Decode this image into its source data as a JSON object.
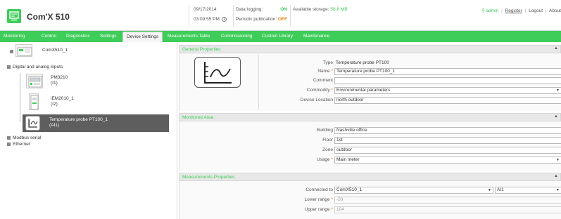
{
  "header": {
    "product_title": "Com'X 510",
    "date": "09/17/2014",
    "time": "03:09:55 PM",
    "data_logging_label": "Data logging:",
    "data_logging_value": "ON",
    "periodic_publication_label": "Periodic publication:",
    "periodic_publication_value": "OFF",
    "storage_label": "Available storage:",
    "storage_value": "58.8 MB",
    "user_icon": "user-icon",
    "user_name": "admin",
    "register": "Register",
    "logout": "Logout",
    "about": "About"
  },
  "nav": {
    "tabs": [
      {
        "label": "Monitoring"
      },
      {
        "label": "Control"
      },
      {
        "label": "Diagnostics"
      },
      {
        "label": "Settings"
      },
      {
        "label": "Device Settings"
      },
      {
        "label": "Measurements Table"
      },
      {
        "label": "Commissioning"
      },
      {
        "label": "Custom Library"
      },
      {
        "label": "Maintenance"
      }
    ],
    "active": "Device Settings"
  },
  "tree": {
    "root": "ComX510_1",
    "group_digital": "Digital and analog inputs",
    "items": [
      {
        "name": "PM3210",
        "sub": "(I1)"
      },
      {
        "name": "iEM2010_1",
        "sub": "(I2)"
      },
      {
        "name": "Temperature probe PT100_1",
        "sub": "(AI1)"
      }
    ],
    "group_modbus": "Modbus serial",
    "group_ethernet": "Ethernet"
  },
  "general": {
    "title": "General Properties",
    "type_label": "Type",
    "type_value": "Temperature probe PT100",
    "name_label": "Name",
    "name_value": "Temperature probe PT100_1",
    "comment_label": "Comment",
    "comment_value": "",
    "commodity_label": "Commodity",
    "commodity_value": "Environmental parameters",
    "location_label": "Device Location",
    "location_value": "north outdoor"
  },
  "monitored": {
    "title": "Monitored Area",
    "building_label": "Building",
    "building_value": "Nashville office",
    "floor_label": "Floor",
    "floor_value": "1st",
    "zone_label": "Zone",
    "zone_value": "outdoor",
    "usage_label": "Usage",
    "usage_value": "Main meter"
  },
  "measurements": {
    "title": "Measurements Properties",
    "connected_label": "Connected to",
    "connected_value": "ComX510_1",
    "connected_input": "AI1",
    "lower_label": "Lower range",
    "lower_value": "-50",
    "upper_label": "Upper range",
    "upper_value": "104"
  },
  "required_mark": "*",
  "colors": {
    "brand_green": "#3dcd58",
    "warning_orange": "#e47f00",
    "selected_dark": "#5e5e5e"
  }
}
